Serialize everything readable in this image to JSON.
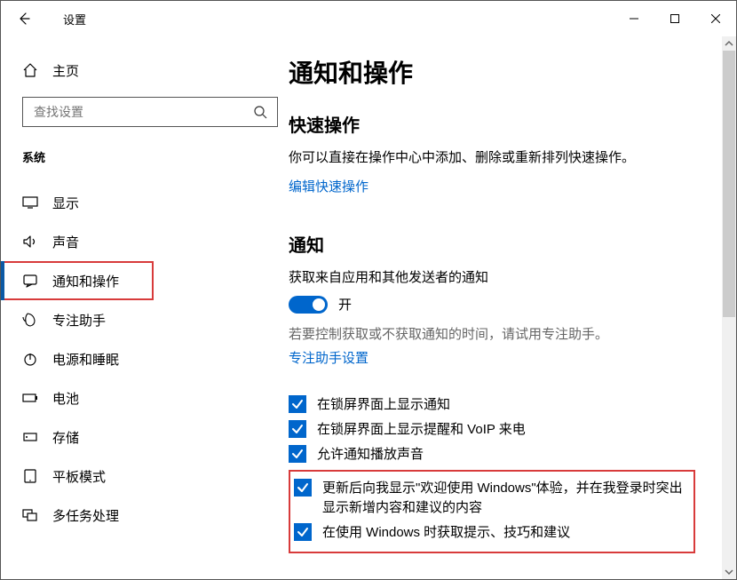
{
  "window": {
    "title": "设置"
  },
  "sidebar": {
    "home": "主页",
    "search_placeholder": "查找设置",
    "group": "系统",
    "items": [
      {
        "icon": "display",
        "label": "显示"
      },
      {
        "icon": "sound",
        "label": "声音"
      },
      {
        "icon": "notif",
        "label": "通知和操作",
        "selected": true
      },
      {
        "icon": "focus",
        "label": "专注助手"
      },
      {
        "icon": "power",
        "label": "电源和睡眠"
      },
      {
        "icon": "battery",
        "label": "电池"
      },
      {
        "icon": "storage",
        "label": "存储"
      },
      {
        "icon": "tablet",
        "label": "平板模式"
      },
      {
        "icon": "multitask",
        "label": "多任务处理"
      }
    ]
  },
  "content": {
    "page_title": "通知和操作",
    "quick_actions": {
      "heading": "快速操作",
      "desc": "你可以直接在操作中心中添加、删除或重新排列快速操作。",
      "link": "编辑快速操作"
    },
    "notifications": {
      "heading": "通知",
      "get_from_apps_label": "获取来自应用和其他发送者的通知",
      "toggle": {
        "on": true,
        "text": "开"
      },
      "control_hint": "若要控制获取或不获取通知的时间，请试用专注助手。",
      "focus_link": "专注助手设置",
      "checks": [
        {
          "checked": true,
          "label": "在锁屏界面上显示通知"
        },
        {
          "checked": true,
          "label": "在锁屏界面上显示提醒和 VoIP 来电"
        },
        {
          "checked": true,
          "label": "允许通知播放声音"
        },
        {
          "checked": true,
          "label": "更新后向我显示\"欢迎使用 Windows\"体验，并在我登录时突出显示新增内容和建议的内容"
        },
        {
          "checked": true,
          "label": "在使用 Windows 时获取提示、技巧和建议"
        }
      ]
    }
  }
}
